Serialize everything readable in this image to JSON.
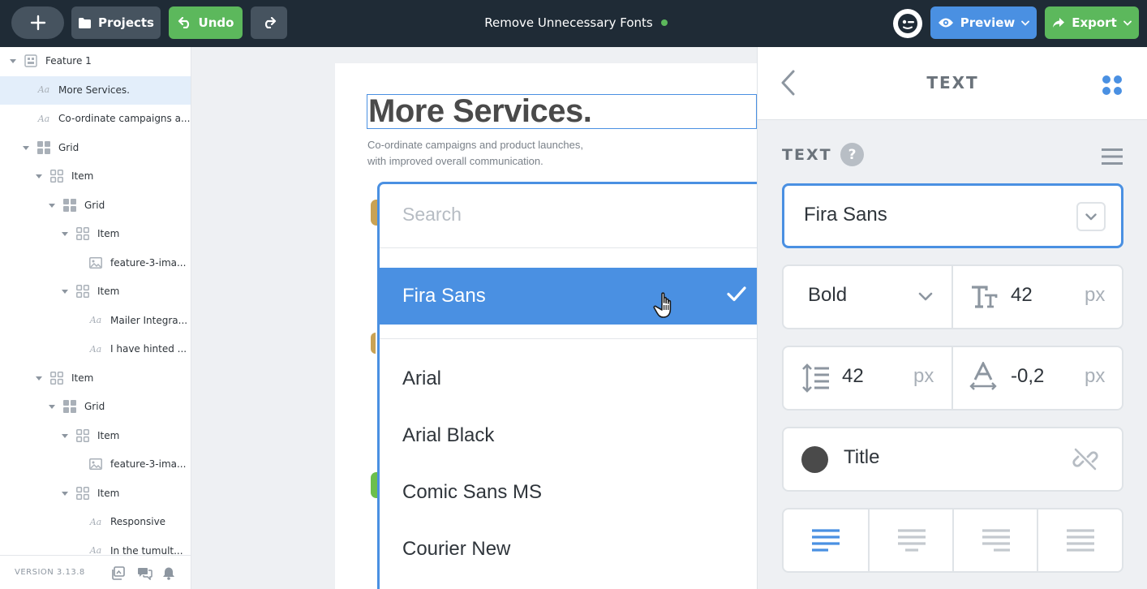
{
  "topbar": {
    "projects_label": "Projects",
    "undo_label": "Undo",
    "document_title": "Remove Unnecessary Fonts",
    "preview_label": "Preview",
    "export_label": "Export",
    "colors": {
      "bar": "#1f2b36",
      "green": "#5cb85c",
      "blue": "#4a90e2"
    }
  },
  "layers": {
    "items": [
      {
        "label": "Feature 1",
        "icon": "section-icon"
      },
      {
        "label": "More Services.",
        "icon": "text-icon"
      },
      {
        "label": "Co-ordinate campaigns a...",
        "icon": "text-icon"
      },
      {
        "label": "Grid",
        "icon": "grid-icon"
      },
      {
        "label": "Item",
        "icon": "grid-item-icon"
      },
      {
        "label": "Grid",
        "icon": "grid-icon"
      },
      {
        "label": "Item",
        "icon": "grid-item-icon"
      },
      {
        "label": "feature-3-ima...",
        "icon": "image-icon"
      },
      {
        "label": "Item",
        "icon": "grid-item-icon"
      },
      {
        "label": "Mailer Integra...",
        "icon": "text-icon"
      },
      {
        "label": "I have hinted ...",
        "icon": "text-icon"
      },
      {
        "label": "Item",
        "icon": "grid-item-icon"
      },
      {
        "label": "Grid",
        "icon": "grid-icon"
      },
      {
        "label": "Item",
        "icon": "grid-item-icon"
      },
      {
        "label": "feature-3-ima...",
        "icon": "image-icon"
      },
      {
        "label": "Item",
        "icon": "grid-item-icon"
      },
      {
        "label": "Responsive",
        "icon": "text-icon"
      },
      {
        "label": "In the tumult...",
        "icon": "text-icon"
      }
    ],
    "selected_index": 1,
    "text_icon_glyph": "Aa",
    "version": "VERSION 3.13.8"
  },
  "canvas": {
    "title": "More Services.",
    "subtitle_line1": "Co-ordinate campaigns and product launches,",
    "subtitle_line2": "with improved overall communication."
  },
  "font_dropdown": {
    "search_placeholder": "Search",
    "selected": "Fira Sans",
    "options": [
      "Arial",
      "Arial Black",
      "Comic Sans MS",
      "Courier New"
    ]
  },
  "inspector": {
    "header_title": "TEXT",
    "section_label": "TEXT",
    "help_glyph": "?",
    "font_family": "Fira Sans",
    "font_weight": "Bold",
    "font_size": "42",
    "font_size_unit": "px",
    "line_height": "42",
    "line_height_unit": "px",
    "letter_spacing": "-0,2",
    "letter_spacing_unit": "px",
    "color_style": "Title",
    "color_swatch": "#4a4a4a",
    "alignment_selected": "left"
  }
}
